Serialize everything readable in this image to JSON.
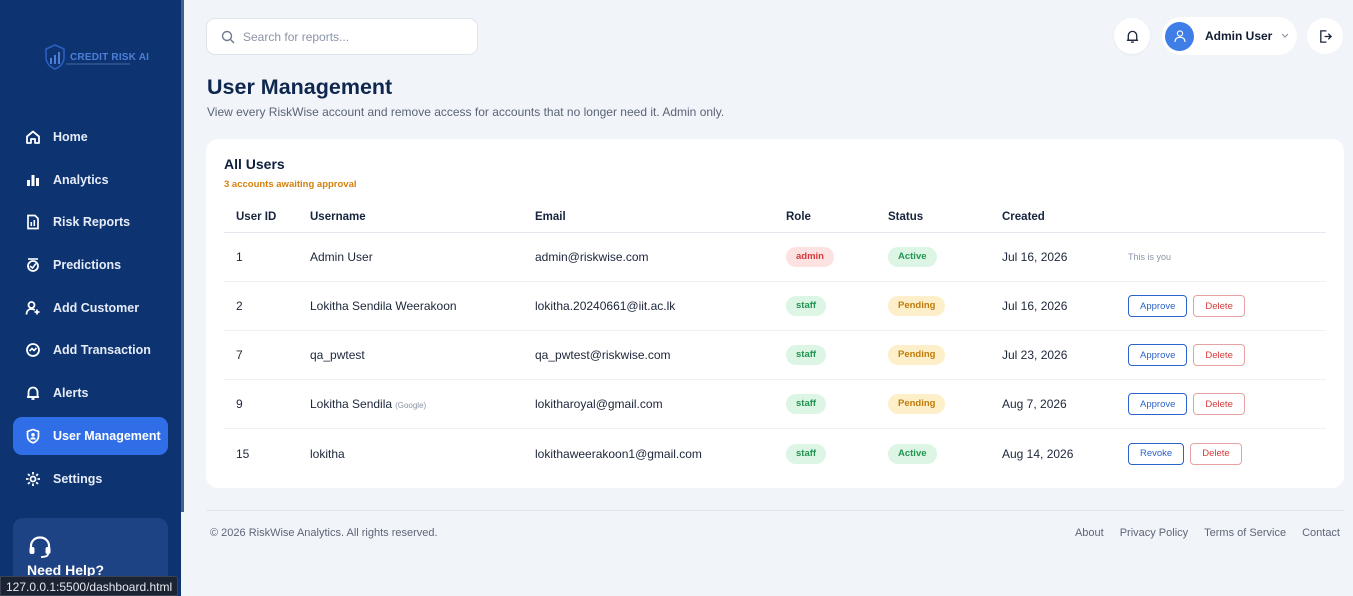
{
  "brand": {
    "logo_text": "CREDIT RISK AI"
  },
  "sidebar": {
    "items": [
      {
        "label": "Home",
        "icon": "home-icon"
      },
      {
        "label": "Analytics",
        "icon": "bar-chart-icon"
      },
      {
        "label": "Risk Reports",
        "icon": "report-icon"
      },
      {
        "label": "Predictions",
        "icon": "prediction-icon"
      },
      {
        "label": "Add Customer",
        "icon": "add-user-icon"
      },
      {
        "label": "Add Transaction",
        "icon": "transaction-icon"
      },
      {
        "label": "Alerts",
        "icon": "bell-icon"
      },
      {
        "label": "User Management",
        "icon": "shield-user-icon",
        "active": true
      },
      {
        "label": "Settings",
        "icon": "gear-icon"
      }
    ],
    "help": {
      "title": "Need Help?"
    }
  },
  "browser": {
    "status_url": "127.0.0.1:5500/dashboard.html"
  },
  "header": {
    "search_placeholder": "Search for reports...",
    "user_name": "Admin User"
  },
  "page": {
    "title": "User Management",
    "subtitle": "View every RiskWise account and remove access for accounts that no longer need it. Admin only."
  },
  "users_card": {
    "title": "All Users",
    "note": "3 accounts awaiting approval",
    "columns": [
      "User ID",
      "Username",
      "Email",
      "Role",
      "Status",
      "Created"
    ],
    "rows": [
      {
        "id": "1",
        "username": "Admin User",
        "tag": "",
        "email": "admin@riskwise.com",
        "role": "admin",
        "status": "Active",
        "created": "Jul 16, 2026",
        "self_note": "This is you",
        "actions": []
      },
      {
        "id": "2",
        "username": "Lokitha Sendila Weerakoon",
        "tag": "",
        "email": "lokitha.20240661@iit.ac.lk",
        "role": "staff",
        "status": "Pending",
        "created": "Jul 16, 2026",
        "self_note": "",
        "actions": [
          "Approve",
          "Delete"
        ]
      },
      {
        "id": "7",
        "username": "qa_pwtest",
        "tag": "",
        "email": "qa_pwtest@riskwise.com",
        "role": "staff",
        "status": "Pending",
        "created": "Jul 23, 2026",
        "self_note": "",
        "actions": [
          "Approve",
          "Delete"
        ]
      },
      {
        "id": "9",
        "username": "Lokitha Sendila",
        "tag": "(Google)",
        "email": "lokitharoyal@gmail.com",
        "role": "staff",
        "status": "Pending",
        "created": "Aug 7, 2026",
        "self_note": "",
        "actions": [
          "Approve",
          "Delete"
        ]
      },
      {
        "id": "15",
        "username": "lokitha",
        "tag": "",
        "email": "lokithaweerakoon1@gmail.com",
        "role": "staff",
        "status": "Active",
        "created": "Aug 14, 2026",
        "self_note": "",
        "actions": [
          "Revoke",
          "Delete"
        ]
      }
    ]
  },
  "footer": {
    "copyright": "© 2026 RiskWise Analytics. All rights reserved.",
    "links": [
      "About",
      "Privacy Policy",
      "Terms of Service",
      "Contact"
    ]
  },
  "colors": {
    "sidebar_bg": "#0d3371",
    "accent": "#2f6ee7",
    "page_bg": "#f1f4f9"
  }
}
